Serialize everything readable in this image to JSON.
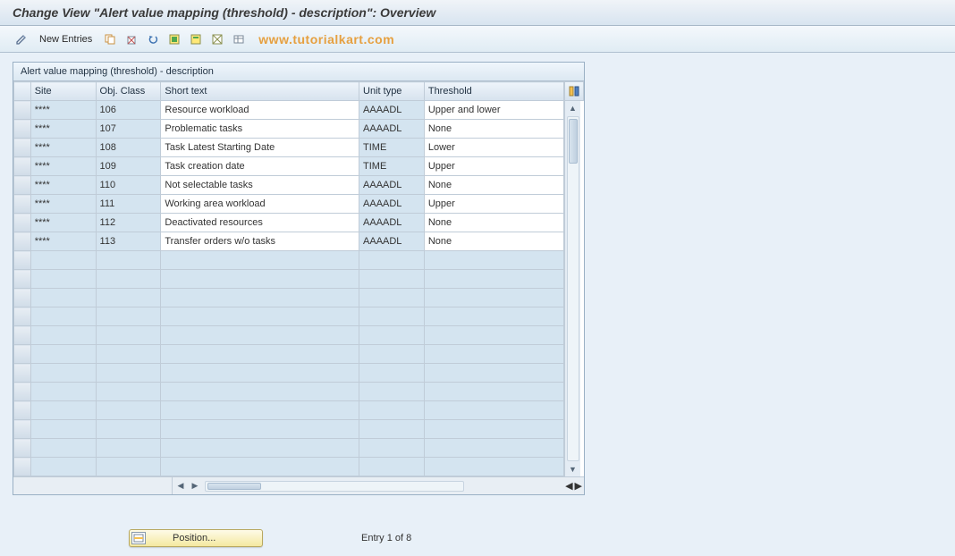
{
  "title": "Change View \"Alert value mapping (threshold)  - description\": Overview",
  "toolbar": {
    "new_entries": "New Entries"
  },
  "watermark": "www.tutorialkart.com",
  "grid": {
    "caption": "Alert value mapping (threshold)  - description",
    "columns": {
      "site": "Site",
      "obj_class": "Obj. Class",
      "short_text": "Short text",
      "unit_type": "Unit type",
      "threshold": "Threshold"
    },
    "rows": [
      {
        "site": "****",
        "obj": "106",
        "short": "Resource workload",
        "unit": "AAAADL",
        "thr": "Upper and lower"
      },
      {
        "site": "****",
        "obj": "107",
        "short": "Problematic tasks",
        "unit": "AAAADL",
        "thr": "None"
      },
      {
        "site": "****",
        "obj": "108",
        "short": "Task Latest Starting Date",
        "unit": "TIME",
        "thr": "Lower"
      },
      {
        "site": "****",
        "obj": "109",
        "short": "Task creation date",
        "unit": "TIME",
        "thr": "Upper"
      },
      {
        "site": "****",
        "obj": "110",
        "short": "Not selectable tasks",
        "unit": "AAAADL",
        "thr": "None"
      },
      {
        "site": "****",
        "obj": "111",
        "short": "Working area workload",
        "unit": "AAAADL",
        "thr": "Upper"
      },
      {
        "site": "****",
        "obj": "112",
        "short": "Deactivated resources",
        "unit": "AAAADL",
        "thr": "None"
      },
      {
        "site": "****",
        "obj": "113",
        "short": "Transfer orders w/o tasks",
        "unit": "AAAADL",
        "thr": "None"
      }
    ],
    "empty_rows": 12
  },
  "footer": {
    "position_label": "Position...",
    "entry_text": "Entry 1 of 8"
  }
}
